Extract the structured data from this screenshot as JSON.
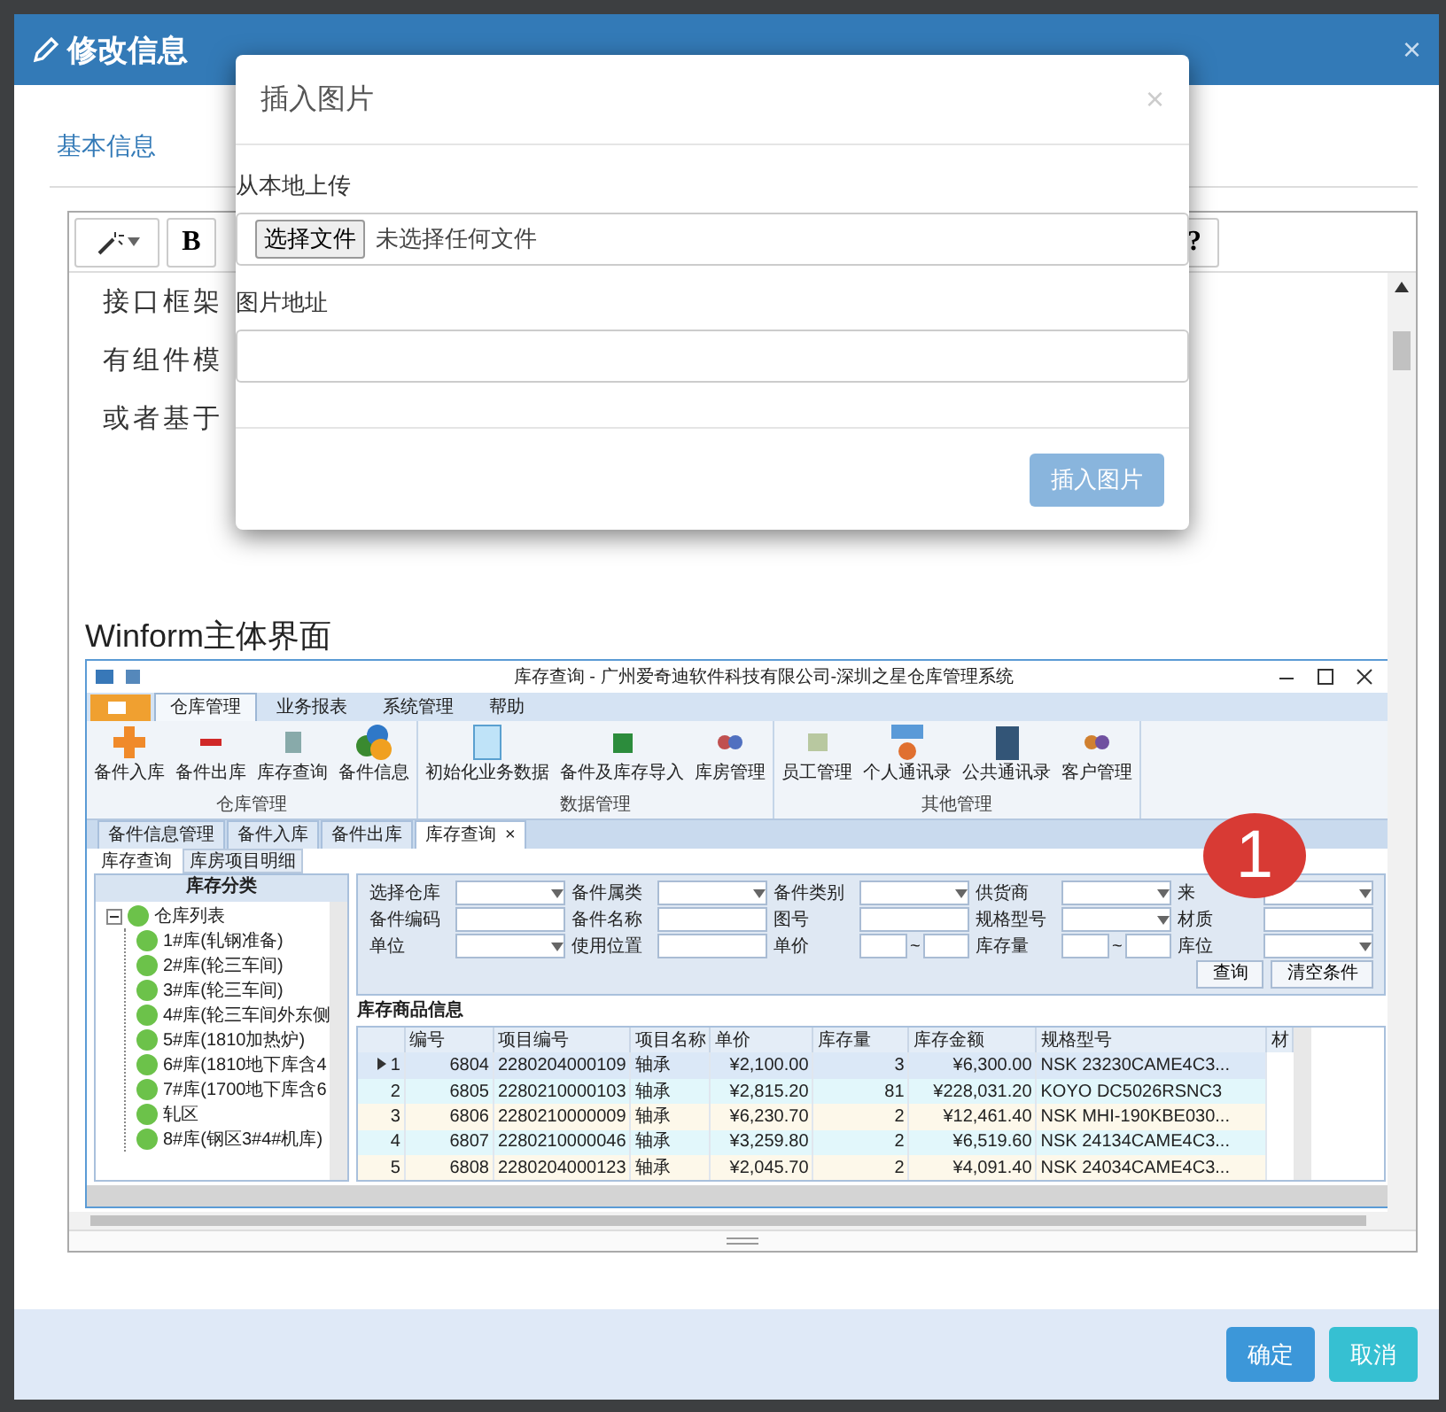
{
  "dialog": {
    "title": "修改信息",
    "close": "×",
    "tabs": [
      {
        "label": "基本信息",
        "selected": false
      }
    ],
    "toolbar": {
      "bold": "B",
      "help": "?"
    },
    "editor": {
      "lines": [
        {
          "text": "接口框架"
        },
        {
          "text": "有组件模"
        },
        {
          "text": "或者基于"
        }
      ],
      "heading": "Winform主体界面",
      "screenshot": {
        "title": "库存查询 - 广州爱奇迪软件科技有限公司-深圳之星仓库管理系统",
        "ribbon_tabs": [
          {
            "label": "仓库管理",
            "selected": true
          },
          {
            "label": "业务报表",
            "selected": false
          },
          {
            "label": "系统管理",
            "selected": false
          },
          {
            "label": "帮助",
            "selected": false
          }
        ],
        "groups": [
          {
            "label": "仓库管理",
            "items": [
              "备件入库",
              "备件出库",
              "库存查询",
              "备件信息"
            ]
          },
          {
            "label": "数据管理",
            "items": [
              "初始化业务数据",
              "备件及库存导入",
              "库房管理"
            ]
          },
          {
            "label": "其他管理",
            "items": [
              "员工管理",
              "个人通讯录",
              "公共通讯录",
              "客户管理"
            ]
          }
        ],
        "doc_tabs": [
          {
            "label": "备件信息管理",
            "selected": false
          },
          {
            "label": "备件入库",
            "selected": false
          },
          {
            "label": "备件出库",
            "selected": false
          },
          {
            "label": "库存查询",
            "selected": true,
            "close": "×"
          }
        ],
        "sub_tabs": [
          {
            "label": "库存查询",
            "selected": true
          },
          {
            "label": "库房项目明细",
            "selected": false
          }
        ],
        "tree": {
          "header": "库存分类",
          "nodes": [
            {
              "label": "仓库列表",
              "expanded": true,
              "children": [
                {
                  "label": "1#库(轧钢准备)"
                },
                {
                  "label": "2#库(轮三车间)"
                },
                {
                  "label": "3#库(轮三车间)"
                },
                {
                  "label": "4#库(轮三车间外东侧"
                },
                {
                  "label": "5#库(1810加热炉)"
                },
                {
                  "label": "6#库(1810地下库含4"
                },
                {
                  "label": "7#库(1700地下库含6"
                },
                {
                  "label": "轧区"
                },
                {
                  "label": "8#库(钢区3#4#机库)"
                }
              ]
            }
          ]
        },
        "filters": {
          "rows": [
            [
              {
                "label": "选择仓库",
                "kind": "combo"
              },
              {
                "label": "备件属类",
                "kind": "combo"
              },
              {
                "label": "备件类别",
                "kind": "combo"
              },
              {
                "label": "供货商",
                "kind": "combo"
              },
              {
                "label": "来",
                "kind": "combo"
              }
            ],
            [
              {
                "label": "备件编码",
                "kind": "text"
              },
              {
                "label": "备件名称",
                "kind": "text"
              },
              {
                "label": "图号",
                "kind": "text"
              },
              {
                "label": "规格型号",
                "kind": "combo"
              },
              {
                "label": "材质",
                "kind": "text"
              }
            ],
            [
              {
                "label": "单位",
                "kind": "combo"
              },
              {
                "label": "使用位置",
                "kind": "text"
              },
              {
                "label": "单价",
                "kind": "range",
                "separator": "~"
              },
              {
                "label": "库存量",
                "kind": "range",
                "separator": "~"
              },
              {
                "label": "库位",
                "kind": "combo"
              }
            ]
          ],
          "buttons": [
            "查询",
            "清空条件"
          ]
        },
        "grid": {
          "caption": "库存商品信息",
          "columns": [
            "编号",
            "项目编号",
            "项目名称",
            "单价",
            "库存量",
            "库存金额",
            "规格型号",
            "材"
          ],
          "rows": [
            {
              "index": "1",
              "selected": true,
              "cells": [
                "6804",
                "2280204000109",
                "轴承",
                "¥2,100.00",
                "3",
                "¥6,300.00",
                "NSK 23230CAME4C3..."
              ]
            },
            {
              "index": "2",
              "selected": false,
              "cells": [
                "6805",
                "2280210000103",
                "轴承",
                "¥2,815.20",
                "81",
                "¥228,031.20",
                "KOYO DC5026RSNC3"
              ]
            },
            {
              "index": "3",
              "selected": false,
              "cells": [
                "6806",
                "2280210000009",
                "轴承",
                "¥6,230.70",
                "2",
                "¥12,461.40",
                "NSK MHI-190KBE030..."
              ]
            },
            {
              "index": "4",
              "selected": false,
              "cells": [
                "6807",
                "2280210000046",
                "轴承",
                "¥3,259.80",
                "2",
                "¥6,519.60",
                "NSK 24134CAME4C3..."
              ]
            },
            {
              "index": "5",
              "selected": false,
              "cells": [
                "6808",
                "2280204000123",
                "轴承",
                "¥2,045.70",
                "2",
                "¥4,091.40",
                "NSK 24034CAME4C3..."
              ]
            }
          ]
        },
        "badge": "1"
      }
    },
    "buttons": [
      {
        "label": "确定",
        "kind": "primary"
      },
      {
        "label": "取消",
        "kind": "info"
      }
    ]
  },
  "insert_image": {
    "title": "插入图片",
    "close": "×",
    "upload_label": "从本地上传",
    "file_button": "选择文件",
    "file_status": "未选择任何文件",
    "url_label": "图片地址",
    "submit": {
      "label": "插入图片",
      "disabled": true
    }
  }
}
